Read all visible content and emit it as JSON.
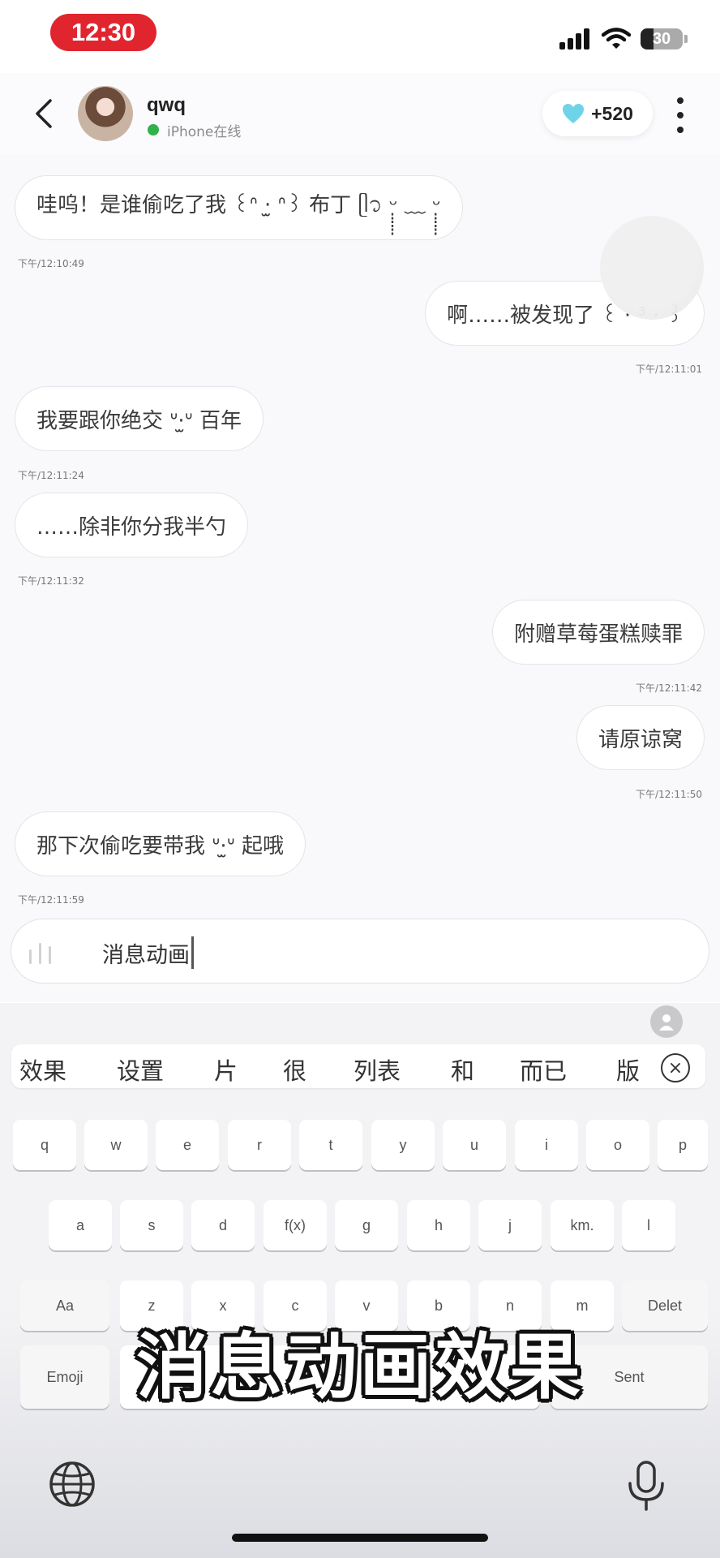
{
  "status_bar": {
    "time": "12:30",
    "battery": "30"
  },
  "header": {
    "contact_name": "qwq",
    "status": "iPhone在线",
    "heart_value": "+520",
    "heart_color": "#6fd3e8"
  },
  "messages": [
    {
      "side": "left",
      "text": "哇呜！是谁偷吃了我 ꒰ᐢ ·̫ ᐢ꒱ 布丁 ᥫ᭡ ᵕ̣̣̣̣̣̣ ﹏ ᵕ̣̣̣̣̣̣",
      "time": "下午/12:10:49"
    },
    {
      "side": "right",
      "text": "啊……被发现了 ꒰ · ³ · ꒱",
      "time": "下午/12:11:01"
    },
    {
      "side": "left",
      "text": "我要跟你绝交 ᐡ·̫ᐡ 百年",
      "time": "下午/12:11:24"
    },
    {
      "side": "left",
      "text": "……除非你分我半勺",
      "time": "下午/12:11:32"
    },
    {
      "side": "right",
      "text": "附赠草莓蛋糕赎罪",
      "time": "下午/12:11:42"
    },
    {
      "side": "right",
      "text": "请原谅窝",
      "time": "下午/12:11:50"
    },
    {
      "side": "left",
      "text": "那下次偷吃要带我 ᐡ·̫ᐡ 起哦",
      "time": "下午/12:11:59"
    }
  ],
  "input": {
    "value": "消息动画"
  },
  "candidates": [
    "效果",
    "设置",
    "片",
    "很",
    "列表",
    "和",
    "而已",
    "版"
  ],
  "keyboard": {
    "row1": [
      "q",
      "w",
      "e",
      "r",
      "t",
      "y",
      "u",
      "i",
      "o",
      "p"
    ],
    "row2": [
      "a",
      "s",
      "d",
      "f(x)",
      "g",
      "h",
      "j",
      "km.",
      "l"
    ],
    "row3": [
      "Aa",
      "z",
      "x",
      "c",
      "v",
      "b",
      "n",
      "m",
      "Delet"
    ],
    "row4": {
      "emoji": "Emoji",
      "space": "Space",
      "send": "Sent"
    }
  },
  "overlay_caption": "消息动画效果"
}
